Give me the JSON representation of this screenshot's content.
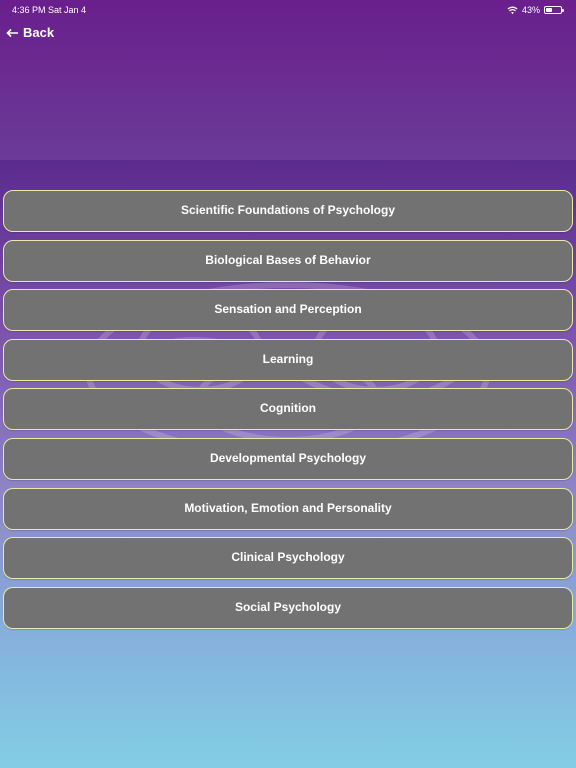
{
  "status_bar": {
    "time_date": "4:36 PM   Sat Jan 4",
    "battery": "43%",
    "battery_level": 0.43
  },
  "nav": {
    "back_label": "Back"
  },
  "topics": [
    "Scientific Foundations of Psychology",
    "Biological Bases of Behavior",
    "Sensation and Perception",
    "Learning",
    "Cognition",
    "Developmental Psychology",
    "Motivation, Emotion and Personality",
    "Clinical Psychology",
    "Social Psychology"
  ],
  "colors": {
    "header_top": "#6a1f8c",
    "button_bg": "#727272",
    "button_border": "#e8eca8",
    "bottom_sky": "#82cde6"
  }
}
